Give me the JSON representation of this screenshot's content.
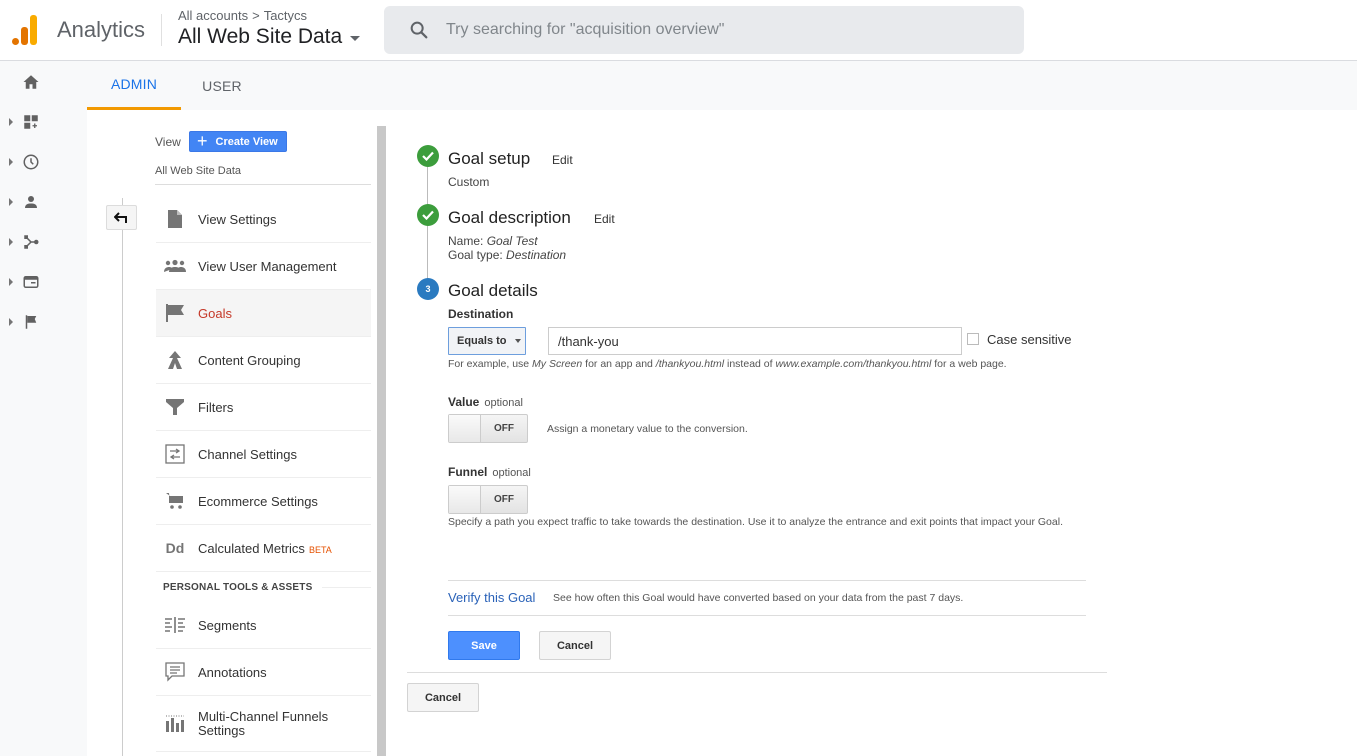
{
  "header": {
    "app_name": "Analytics",
    "breadcrumb": [
      "All accounts",
      "Tactycs"
    ],
    "breadcrumb_sep": ">",
    "property": "All Web Site Data",
    "search_placeholder": "Try searching for \"acquisition overview\""
  },
  "rail": {
    "items": [
      {
        "name": "home",
        "icon": "home-icon",
        "expandable": false
      },
      {
        "name": "customization",
        "icon": "dashboard-add-icon",
        "expandable": true
      },
      {
        "name": "realtime",
        "icon": "clock-icon",
        "expandable": true
      },
      {
        "name": "audience",
        "icon": "person-icon",
        "expandable": true
      },
      {
        "name": "acquisition",
        "icon": "acquisition-icon",
        "expandable": true
      },
      {
        "name": "behavior",
        "icon": "behavior-icon",
        "expandable": true
      },
      {
        "name": "conversions",
        "icon": "flag-icon",
        "expandable": true
      }
    ]
  },
  "tabs": [
    {
      "label": "ADMIN",
      "active": true
    },
    {
      "label": "USER",
      "active": false
    }
  ],
  "view_panel": {
    "view_label": "View",
    "create_view_label": "Create View",
    "view_name": "All Web Site Data",
    "items": [
      {
        "label": "View Settings",
        "icon": "document-icon",
        "active": false
      },
      {
        "label": "View User Management",
        "icon": "people-icon",
        "active": false
      },
      {
        "label": "Goals",
        "icon": "flag-icon",
        "active": true
      },
      {
        "label": "Content Grouping",
        "icon": "content-grouping-icon",
        "active": false
      },
      {
        "label": "Filters",
        "icon": "filter-icon",
        "active": false
      },
      {
        "label": "Channel Settings",
        "icon": "channel-settings-icon",
        "active": false
      },
      {
        "label": "Ecommerce Settings",
        "icon": "cart-icon",
        "active": false
      },
      {
        "label": "Calculated Metrics",
        "badge": "BETA",
        "icon": "calculated-metrics-icon",
        "active": false
      }
    ],
    "section_header": "PERSONAL TOOLS & ASSETS",
    "personal_items": [
      {
        "label": "Segments",
        "icon": "segments-icon"
      },
      {
        "label": "Annotations",
        "icon": "annotations-icon"
      },
      {
        "label": "Multi-Channel Funnels Settings",
        "icon": "mcf-icon"
      }
    ]
  },
  "goal_form": {
    "steps": [
      {
        "number": "1",
        "title": "Goal setup",
        "edit": "Edit",
        "status": "done",
        "summary": "Custom"
      },
      {
        "number": "2",
        "title": "Goal description",
        "edit": "Edit",
        "status": "done",
        "name_label": "Name:",
        "name_value": "Goal Test",
        "type_label": "Goal type:",
        "type_value": "Destination"
      },
      {
        "number": "3",
        "title": "Goal details",
        "status": "current"
      }
    ],
    "destination": {
      "label": "Destination",
      "match_type": "Equals to",
      "value": "/thank-you",
      "case_sensitive_label": "Case sensitive",
      "case_sensitive": false,
      "hint_parts": [
        "For example, use ",
        "My Screen",
        " for an app and ",
        "/thankyou.html",
        " instead of ",
        "www.example.com/thankyou.html",
        " for a web page."
      ]
    },
    "value": {
      "label": "Value",
      "optional": "optional",
      "toggle": "OFF",
      "description": "Assign a monetary value to the conversion."
    },
    "funnel": {
      "label": "Funnel",
      "optional": "optional",
      "toggle": "OFF",
      "description": "Specify a path you expect traffic to take towards the destination. Use it to analyze the entrance and exit points that impact your Goal."
    },
    "verify": {
      "link": "Verify this Goal",
      "description": "See how often this Goal would have converted based on your data from the past 7 days."
    },
    "save_label": "Save",
    "cancel_label": "Cancel",
    "outer_cancel_label": "Cancel"
  },
  "colors": {
    "accent_blue": "#1a73e8",
    "tab_underline": "#f29900",
    "active_nav": "#c53929",
    "done_green": "#3c9d3c",
    "step_blue": "#2a7ac0",
    "primary_button": "#4d90fe"
  }
}
